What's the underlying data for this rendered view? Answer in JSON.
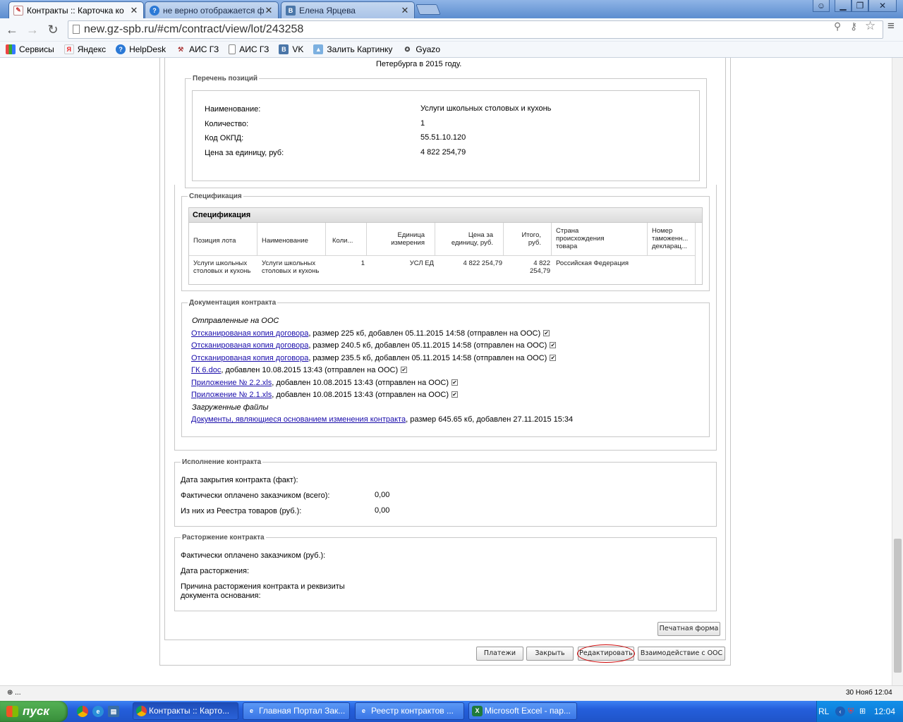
{
  "browser": {
    "tabs": [
      {
        "title": "Контракты :: Карточка ко",
        "active": true
      },
      {
        "title": "не верно отображается фи",
        "active": false
      },
      {
        "title": "Елена Ярцева",
        "active": false
      }
    ],
    "url": "new.gz-spb.ru/#cm/contract/view/lot/243258",
    "bookmarks": [
      "Сервисы",
      "Яндекс",
      "HelpDesk",
      "АИС ГЗ",
      "АИС ГЗ",
      "VK",
      "Залить Картинку",
      "Gyazo"
    ],
    "status_text": "⊕ ...",
    "status_datetime": "30 Нояб 12:04"
  },
  "page": {
    "top_text": "Петербурга в 2015 году.",
    "positions": {
      "legend": "Перечень позиций",
      "rows": [
        {
          "label": "Наименование:",
          "value": "Услуги школьных столовых и кухонь"
        },
        {
          "label": "Количество:",
          "value": "1"
        },
        {
          "label": "Код ОКПД:",
          "value": "55.51.10.120"
        },
        {
          "label": "Цена за единицу, руб:",
          "value": "4 822 254,79"
        }
      ]
    },
    "spec": {
      "legend": "Спецификация",
      "title": "Спецификация",
      "headers": [
        "Позиция лота",
        "Наименование",
        "Коли...",
        "Единица измерения",
        "Цена за единицу, руб.",
        "Итого, руб.",
        "Страна происхождения товара",
        "Номер таможенн... декларац..."
      ],
      "row": [
        "Услуги школьных столовых и кухонь",
        "Услуги школьных столовых и кухонь",
        "1",
        "УСЛ ЕД",
        "4 822 254,79",
        "4 822 254,79",
        "Российская Федерация",
        ""
      ]
    },
    "docs": {
      "legend": "Документация контракта",
      "sent_title": "Отправленные на ООС",
      "sent": [
        {
          "link": "Отсканированая копия договора",
          "rest": ", размер 225 кб, добавлен 05.11.2015 14:58 (отправлен на ООС)"
        },
        {
          "link": "Отсканированая копия договора",
          "rest": ", размер 240.5 кб, добавлен 05.11.2015 14:58 (отправлен на ООС)"
        },
        {
          "link": "Отсканированая копия договора",
          "rest": ", размер 235.5 кб, добавлен 05.11.2015 14:58 (отправлен на ООС)"
        },
        {
          "link": "ГК 6.doc",
          "rest": ", добавлен 10.08.2015 13:43 (отправлен на ООС)"
        },
        {
          "link": "Приложение № 2.2.xls",
          "rest": ", добавлен 10.08.2015 13:43 (отправлен на ООС)"
        },
        {
          "link": "Приложение № 2.1.xls",
          "rest": ", добавлен 10.08.2015 13:43 (отправлен на ООС)"
        }
      ],
      "loaded_title": "Загруженные файлы",
      "loaded": [
        {
          "link": "Документы, являющиеся основанием изменения контракта",
          "rest": ", размер 645.65 кб, добавлен 27.11.2015 15:34"
        }
      ]
    },
    "execution": {
      "legend": "Исполнение контракта",
      "close_date_label": "Дата закрытия контракта (факт):",
      "paid_label": "Фактически оплачено заказчиком (всего):",
      "paid_value": "0,00",
      "registry_label": "Из них из Реестра товаров (руб.):",
      "registry_value": "0,00"
    },
    "termination": {
      "legend": "Расторжение контракта",
      "paid_label": "Фактически оплачено заказчиком (руб.):",
      "date_label": "Дата расторжения:",
      "reason_label_1": "Причина расторжения контракта и реквизиты",
      "reason_label_2": "документа основания:"
    },
    "buttons": {
      "print": "Печатная форма",
      "payments": "Платежи",
      "close": "Закрыть",
      "edit": "Редактировать",
      "oos": "Взаимодействие с ООС"
    }
  },
  "taskbar": {
    "start": "пуск",
    "items": [
      "Контракты :: Карто...",
      "Главная Портал Зак...",
      "Реестр контрактов ...",
      "Microsoft Excel - пар..."
    ],
    "lang": "RL",
    "clock": "12:04"
  }
}
